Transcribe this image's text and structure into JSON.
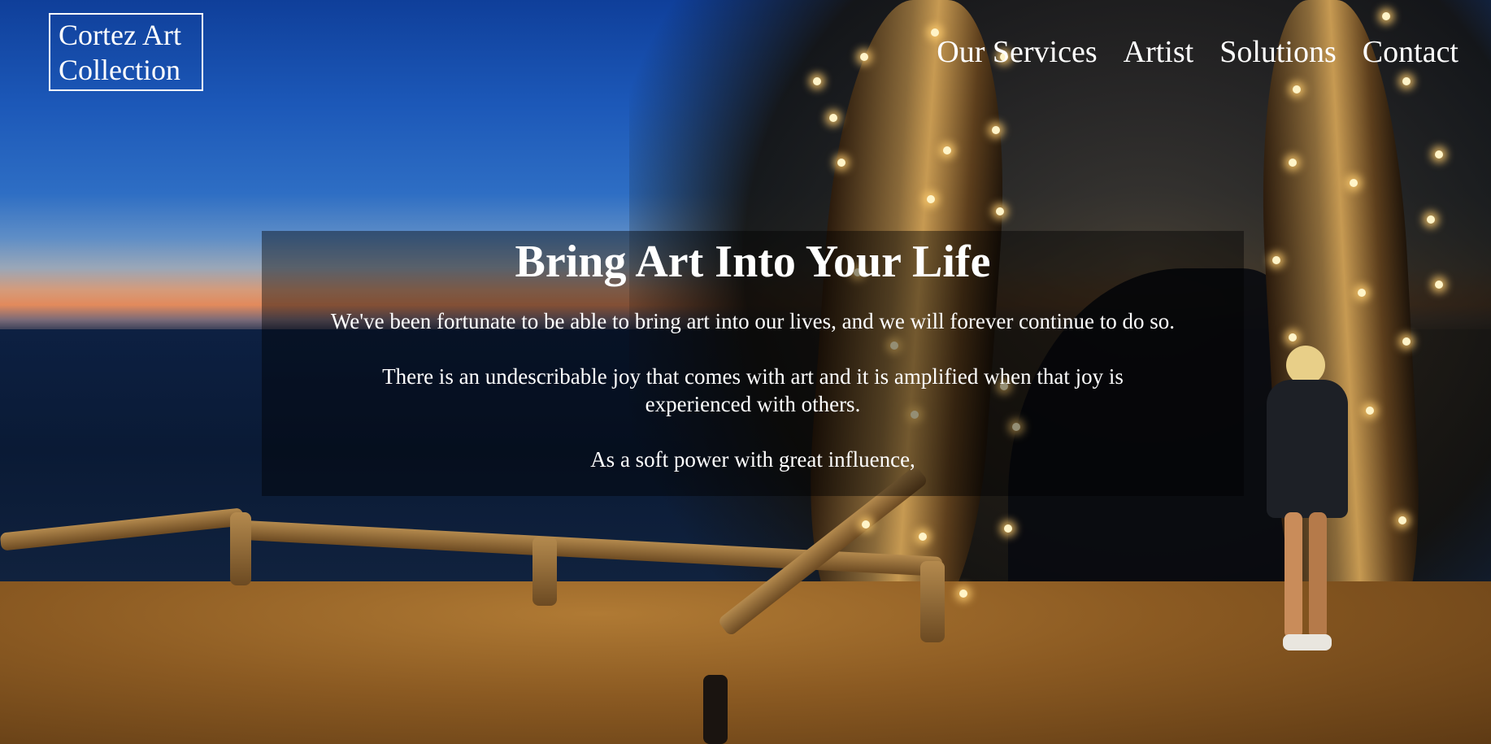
{
  "header": {
    "logo_text": "Cortez Art Collection",
    "nav": [
      {
        "label": "Our Services"
      },
      {
        "label": "Artist"
      },
      {
        "label": "Solutions"
      },
      {
        "label": "Contact"
      }
    ]
  },
  "hero": {
    "title": "Bring Art Into Your Life",
    "paragraphs": [
      "We've been fortunate to be able to bring art into our lives, and we will forever continue to do so.",
      "There is an undescribable joy that comes with art and it is amplified when that joy is experienced with others.",
      "As a soft power with great influence,"
    ]
  },
  "background": {
    "description_icon": "night-coast-string-lights-photo"
  },
  "colors": {
    "text": "#ffffff",
    "overlay": "rgba(0,0,0,0.42)",
    "sky": "#1c58b8"
  }
}
